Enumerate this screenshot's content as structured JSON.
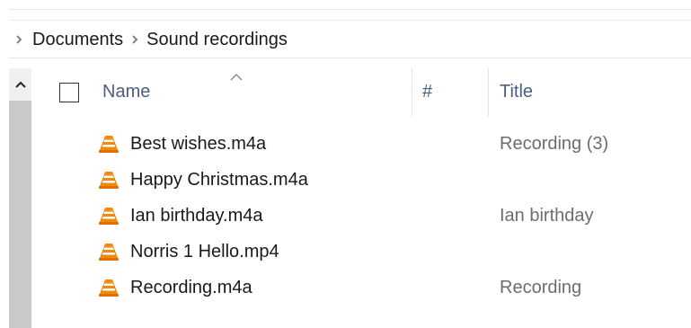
{
  "breadcrumb": {
    "segments": [
      "Documents",
      "Sound recordings"
    ]
  },
  "columns": {
    "name": "Name",
    "number": "#",
    "title": "Title"
  },
  "files": [
    {
      "name": "Best wishes.m4a",
      "title": "Recording (3)",
      "icon": "vlc-cone-icon"
    },
    {
      "name": "Happy Christmas.m4a",
      "title": "",
      "icon": "vlc-cone-icon"
    },
    {
      "name": "Ian birthday.m4a",
      "title": "Ian birthday",
      "icon": "vlc-cone-icon"
    },
    {
      "name": "Norris 1 Hello.mp4",
      "title": "",
      "icon": "vlc-cone-icon"
    },
    {
      "name": "Recording.m4a",
      "title": "Recording",
      "icon": "vlc-cone-icon"
    }
  ],
  "colors": {
    "header_text": "#4a5f7e",
    "vlc_orange": "#f08a0c",
    "secondary_text": "#6d6d6d"
  }
}
